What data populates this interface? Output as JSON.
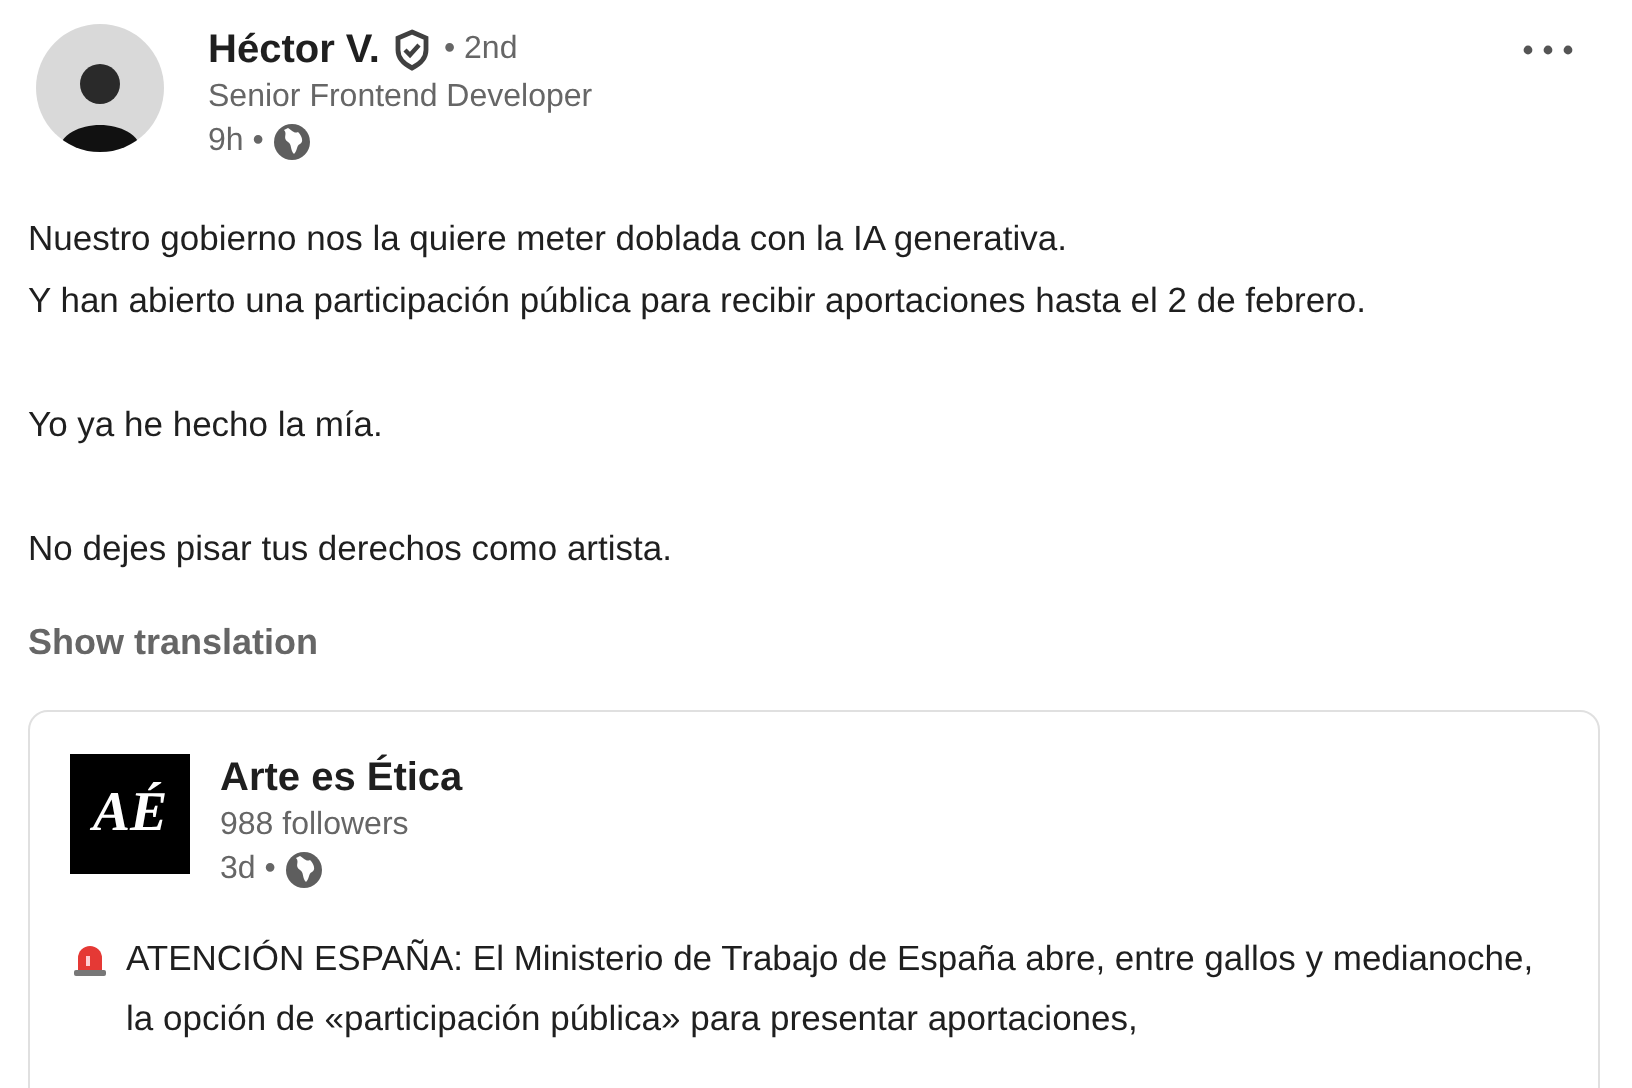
{
  "author": {
    "name": "Héctor V.",
    "degree": "• 2nd",
    "headline": "Senior Frontend Developer",
    "time": "9h •"
  },
  "body": [
    "Nuestro gobierno nos la quiere meter doblada con la IA generativa.\nY han abierto una participación pública para recibir aportaciones hasta el 2 de febrero.",
    "Yo ya he hecho la mía.",
    "No dejes pisar tus derechos como artista."
  ],
  "translation_link": "Show translation",
  "shared_post": {
    "logo_text": "AÉ",
    "name": "Arte es Ética",
    "followers": "988 followers",
    "time": "3d •",
    "text": "ATENCIÓN ESPAÑA: El Ministerio de Trabajo de España abre, entre gallos y medianoche, la opción de «participación pública» para presentar aportaciones,"
  }
}
